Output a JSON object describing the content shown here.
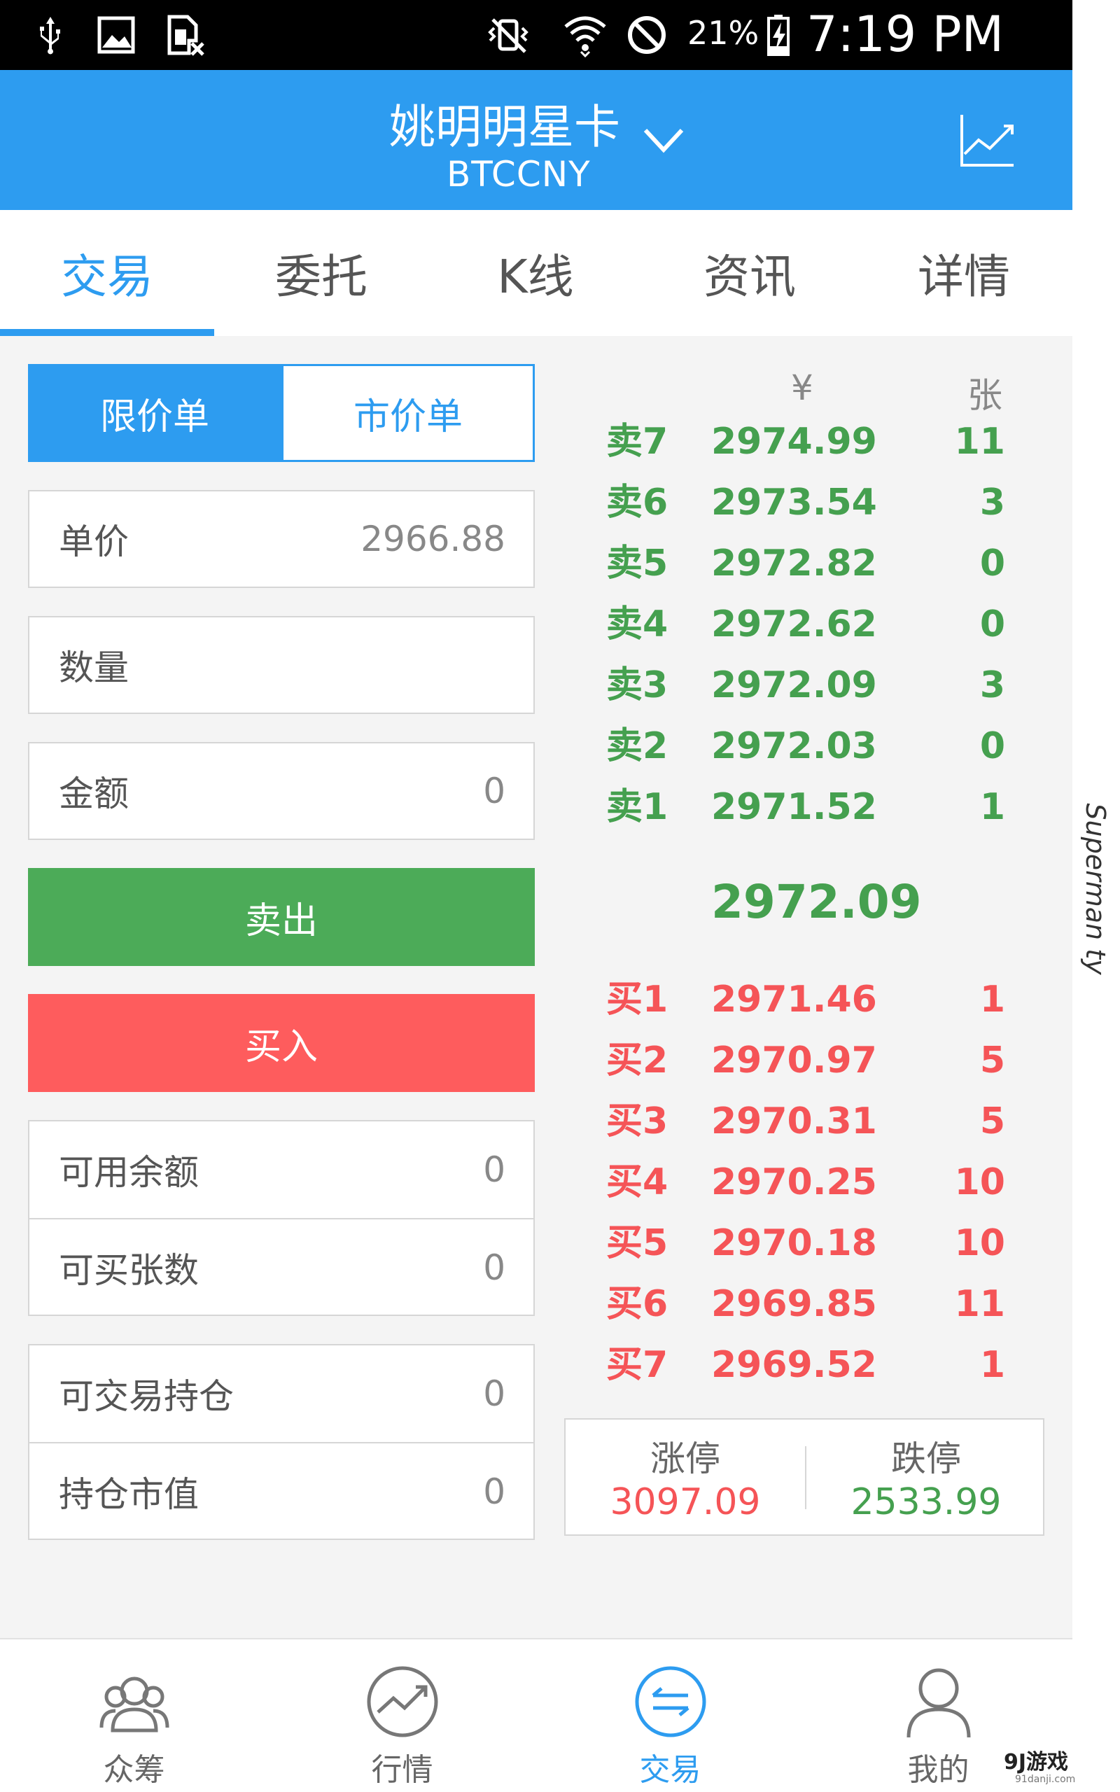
{
  "status_bar": {
    "battery": "21%",
    "time": "7:19 PM"
  },
  "header": {
    "title": "姚明明星卡",
    "subtitle": "BTCCNY",
    "chart_icon": "trend-chart-icon"
  },
  "tabs": [
    "交易",
    "委托",
    "K线",
    "资讯",
    "详情"
  ],
  "active_tab": "交易",
  "order_type": {
    "limit": "限价单",
    "market": "市价单",
    "selected": "限价单"
  },
  "form": {
    "price_label": "单价",
    "price_value": "2966.88",
    "quantity_label": "数量",
    "quantity_value": "",
    "amount_label": "金额",
    "amount_value": "0"
  },
  "actions": {
    "sell": "卖出",
    "buy": "买入"
  },
  "account": {
    "available_balance_label": "可用余额",
    "available_balance": "0",
    "buyable_label": "可买张数",
    "buyable": "0",
    "tradable_position_label": "可交易持仓",
    "tradable_position": "0",
    "position_value_label": "持仓市值",
    "position_value": "0"
  },
  "order_book": {
    "price_header": "¥",
    "qty_header": "张",
    "asks": [
      {
        "label": "卖7",
        "price": "2974.99",
        "qty": "11"
      },
      {
        "label": "卖6",
        "price": "2973.54",
        "qty": "3"
      },
      {
        "label": "卖5",
        "price": "2972.82",
        "qty": "0"
      },
      {
        "label": "卖4",
        "price": "2972.62",
        "qty": "0"
      },
      {
        "label": "卖3",
        "price": "2972.09",
        "qty": "3"
      },
      {
        "label": "卖2",
        "price": "2972.03",
        "qty": "0"
      },
      {
        "label": "卖1",
        "price": "2971.52",
        "qty": "1"
      }
    ],
    "last_price": "2972.09",
    "bids": [
      {
        "label": "买1",
        "price": "2971.46",
        "qty": "1"
      },
      {
        "label": "买2",
        "price": "2970.97",
        "qty": "5"
      },
      {
        "label": "买3",
        "price": "2970.31",
        "qty": "5"
      },
      {
        "label": "买4",
        "price": "2970.25",
        "qty": "10"
      },
      {
        "label": "买5",
        "price": "2970.18",
        "qty": "10"
      },
      {
        "label": "买6",
        "price": "2969.85",
        "qty": "11"
      },
      {
        "label": "买7",
        "price": "2969.52",
        "qty": "1"
      }
    ]
  },
  "limits": {
    "up_label": "涨停",
    "up_value": "3097.09",
    "down_label": "跌停",
    "down_value": "2533.99"
  },
  "bottom_nav": [
    {
      "label": "众筹",
      "icon": "crowd-icon"
    },
    {
      "label": "行情",
      "icon": "market-chart-icon"
    },
    {
      "label": "交易",
      "icon": "exchange-icon"
    },
    {
      "label": "我的",
      "icon": "profile-icon"
    }
  ],
  "active_nav": "交易",
  "watermarks": {
    "side": "Superman ty",
    "corner": "9J游戏",
    "corner_url": "91danji.com"
  },
  "colors": {
    "accent": "#2d9cf0",
    "ask_green": "#45a04f",
    "bid_red": "#f55457",
    "sell_button": "#4cab58",
    "buy_button": "#fe5c5d"
  }
}
